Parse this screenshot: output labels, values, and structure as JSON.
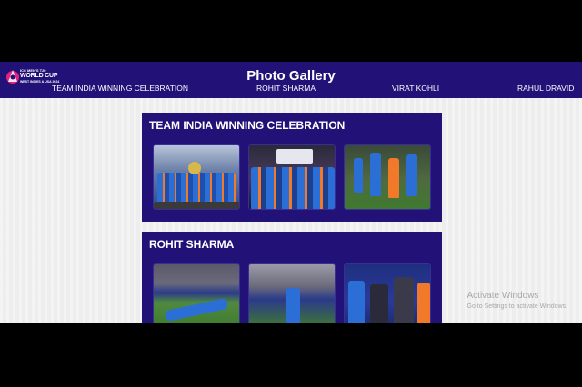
{
  "header": {
    "title": "Photo Gallery",
    "logo": {
      "line1": "ICC MEN'S T20",
      "line2": "WORLD CUP",
      "line3": "WEST INDIES & USA 2024"
    },
    "nav": [
      {
        "label": "TEAM INDIA WINNING CELEBRATION"
      },
      {
        "label": "ROHIT SHARMA"
      },
      {
        "label": "VIRAT KOHLI"
      },
      {
        "label": "RAHUL DRAVID"
      }
    ]
  },
  "sections": [
    {
      "title": "TEAM INDIA WINNING CELEBRATION",
      "photos": [
        "team-celebration-trophy",
        "team-huddle-banner",
        "team-on-field"
      ]
    },
    {
      "title": "ROHIT SHARMA",
      "photos": [
        "rohit-lying-on-ground",
        "rohit-kneeling",
        "rohit-handshake"
      ]
    }
  ],
  "watermark": {
    "line1": "Activate Windows",
    "line2": "Go to Settings to activate Windows."
  },
  "colors": {
    "header_bg": "#221177",
    "section_bg": "#221177",
    "page_bg": "#efefef",
    "jersey_blue": "#2b6fd6",
    "jersey_orange": "#f07a2a"
  }
}
